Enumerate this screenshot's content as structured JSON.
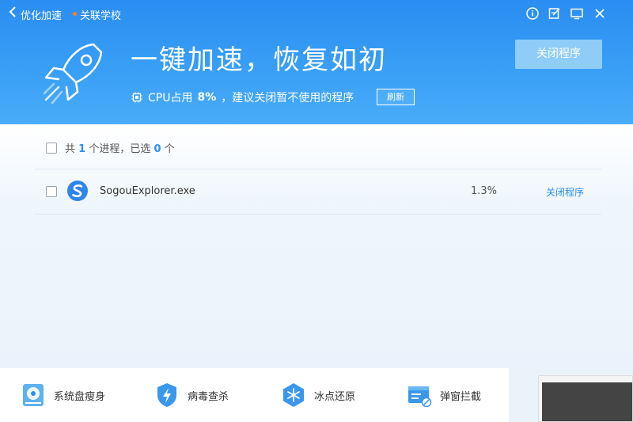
{
  "titlebar": {
    "back_label": "优化加速",
    "tab_label": "关联学校",
    "icons": [
      "info-icon",
      "edit-icon",
      "monitor-icon",
      "close-icon"
    ]
  },
  "banner": {
    "headline": "一键加速，恢复如初",
    "cpu_prefix": "CPU占用",
    "cpu_value": "8%",
    "cpu_suffix": "，建议关闭暂不使用的程序",
    "refresh_label": "刷新",
    "close_button_label": "关闭程序"
  },
  "summary": {
    "prefix": "共",
    "total": "1",
    "mid": "个进程，已选",
    "selected": "0",
    "suffix": "个"
  },
  "processes": [
    {
      "name": "SogouExplorer.exe",
      "cpu": "1.3%",
      "action": "关闭程序",
      "checked": false
    }
  ],
  "toolbar": [
    {
      "label": "系统盘瘦身",
      "icon": "disk-icon"
    },
    {
      "label": "病毒查杀",
      "icon": "shield-bolt-icon"
    },
    {
      "label": "冰点还原",
      "icon": "snowflake-icon"
    },
    {
      "label": "弹窗拦截",
      "icon": "popup-block-icon"
    }
  ],
  "colors": {
    "accent": "#2b8ff0",
    "banner_top": "#2a8df1",
    "dot": "#ff7e1f"
  }
}
